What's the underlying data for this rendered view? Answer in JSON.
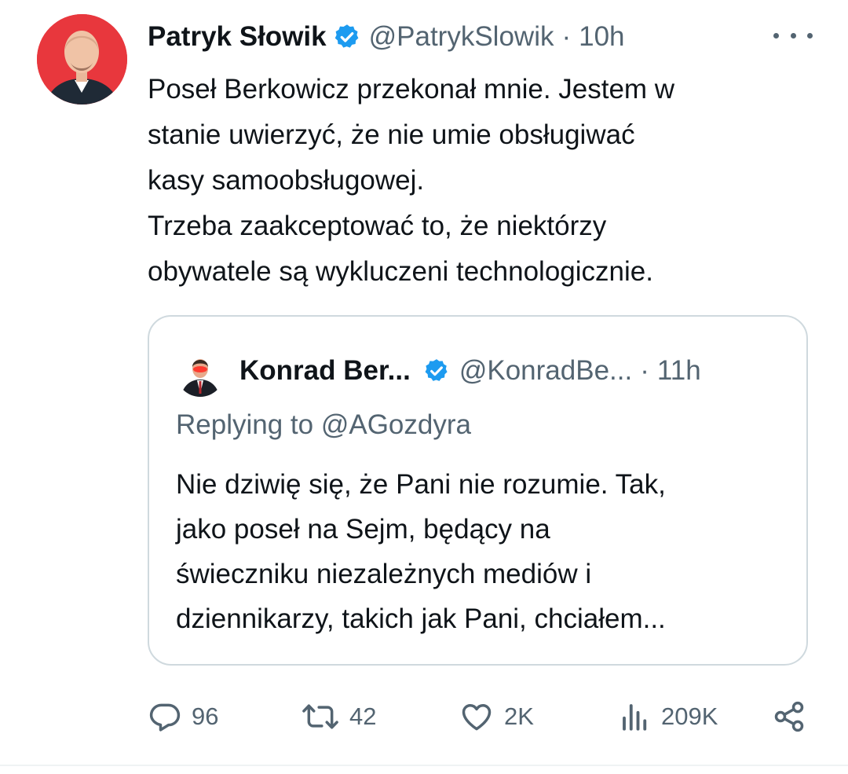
{
  "tweet": {
    "author_name": "Patryk Słowik",
    "author_handle": "@PatrykSlowik",
    "separator": "·",
    "time": "10h",
    "body_lines": [
      "Poseł Berkowicz przekonał mnie. Jestem w",
      "stanie uwierzyć, że nie umie obsługiwać",
      "kasy samoobsługowej.",
      "Trzeba zaakceptować to, że niektórzy",
      "obywatele są wykluczeni technologicznie."
    ]
  },
  "quote": {
    "author_name": "Konrad Ber...",
    "author_handle": "@KonradBe...",
    "separator": "·",
    "time": "11h",
    "replying_to": "Replying to @AGozdyra",
    "body_lines": [
      "Nie dziwię się, że Pani nie rozumie. Tak,",
      "jako poseł na Sejm, będący na",
      "świeczniku niezależnych mediów i",
      "dziennikarzy, takich jak Pani, chciałem..."
    ]
  },
  "actions": {
    "replies": "96",
    "retweets": "42",
    "likes": "2K",
    "views": "209K"
  },
  "icons": [
    "more-icon",
    "verified-icon",
    "reply-icon",
    "retweet-icon",
    "like-icon",
    "views-icon",
    "share-icon"
  ],
  "colors": {
    "text": "#0f1419",
    "secondary": "#536471",
    "verified": "#1d9bf0",
    "border": "#cfd9de",
    "avatar_bg": "#e8373d"
  }
}
